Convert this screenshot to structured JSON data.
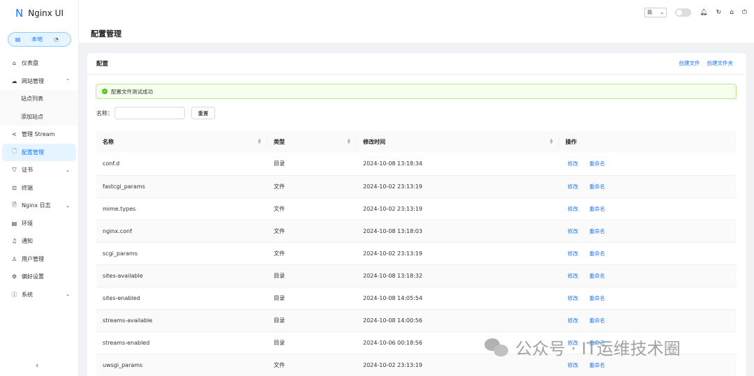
{
  "app": {
    "logo_text": "Nginx UI",
    "env_label": "本地"
  },
  "sidebar": {
    "items": [
      {
        "label": "仪表盘",
        "icon": "home-icon"
      },
      {
        "label": "网站管理",
        "icon": "cloud-icon",
        "expanded": true
      },
      {
        "label": "站点列表",
        "sub": true
      },
      {
        "label": "添加站点",
        "sub": true
      },
      {
        "label": "管理 Stream",
        "icon": "share-icon"
      },
      {
        "label": "配置管理",
        "icon": "file-icon",
        "active": true
      },
      {
        "label": "证书",
        "icon": "shield-icon",
        "chevron": true
      },
      {
        "label": "终端",
        "icon": "terminal-icon"
      },
      {
        "label": "Nginx 日志",
        "icon": "log-icon",
        "chevron": true
      },
      {
        "label": "环境",
        "icon": "database-icon"
      },
      {
        "label": "通知",
        "icon": "bell-icon"
      },
      {
        "label": "用户管理",
        "icon": "user-icon"
      },
      {
        "label": "偏好设置",
        "icon": "settings-icon"
      },
      {
        "label": "系统",
        "icon": "info-icon",
        "chevron": true
      }
    ]
  },
  "topbar": {
    "lang": "简"
  },
  "page": {
    "title": "配置管理"
  },
  "card": {
    "title": "配置",
    "create_file": "创建文件",
    "create_folder": "创建文件夹",
    "alert": "配置文件测试成功",
    "search_label": "名称：",
    "reset": "重置"
  },
  "table": {
    "columns": [
      "名称",
      "类型",
      "修改时间",
      "操作"
    ],
    "edit_label": "修改",
    "rename_label": "重命名",
    "rows": [
      {
        "name": "conf.d",
        "type": "目录",
        "time": "2024-10-08 13:18:34"
      },
      {
        "name": "fastcgi_params",
        "type": "文件",
        "time": "2024-10-02 23:13:19"
      },
      {
        "name": "mime.types",
        "type": "文件",
        "time": "2024-10-02 23:13:19"
      },
      {
        "name": "nginx.conf",
        "type": "文件",
        "time": "2024-10-08 13:18:03"
      },
      {
        "name": "scgi_params",
        "type": "文件",
        "time": "2024-10-02 23:13:19"
      },
      {
        "name": "sites-available",
        "type": "目录",
        "time": "2024-10-08 13:18:32"
      },
      {
        "name": "sites-enabled",
        "type": "目录",
        "time": "2024-10-08 14:05:54"
      },
      {
        "name": "streams-available",
        "type": "目录",
        "time": "2024-10-08 14:00:56"
      },
      {
        "name": "streams-enabled",
        "type": "目录",
        "time": "2024-10-06 00:18:56"
      },
      {
        "name": "uwsgi_params",
        "type": "文件",
        "time": "2024-10-02 23:13:19"
      }
    ]
  },
  "watermark": {
    "text": "公众号 · IT运维技术圈"
  }
}
